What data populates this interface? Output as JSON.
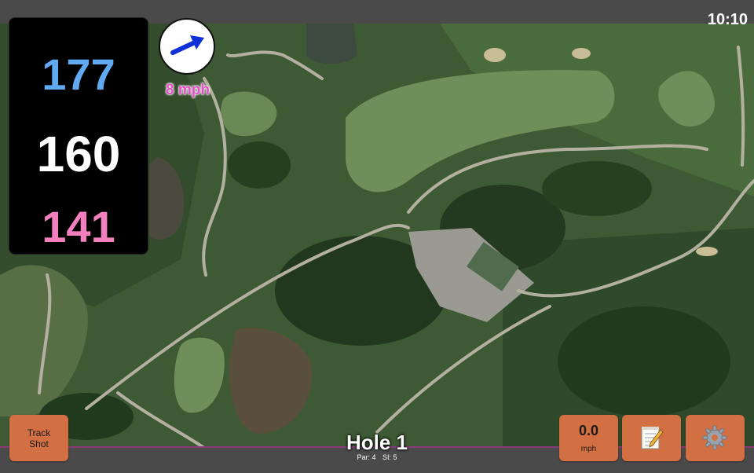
{
  "status": {
    "time": "10:10"
  },
  "yardage": {
    "back": "177",
    "center": "160",
    "front": "141"
  },
  "wind": {
    "speed": "8 mph",
    "direction_icon": "wind-arrow-icon"
  },
  "hole": {
    "title": "Hole 1",
    "par": "Par: 4",
    "si": "SI: 5"
  },
  "buttons": {
    "track_shot": "Track\nShot",
    "speed_value": "0.0",
    "speed_unit": "mph",
    "notes_icon": "notepad-icon",
    "settings_icon": "gear-icon"
  },
  "colors": {
    "back_yardage": "#61a9f0",
    "center_yardage": "#ffffff",
    "front_yardage": "#f27fbe",
    "button": "#d26f43",
    "accent_border": "#8a3a7a",
    "wind_text": "#e251c6"
  }
}
